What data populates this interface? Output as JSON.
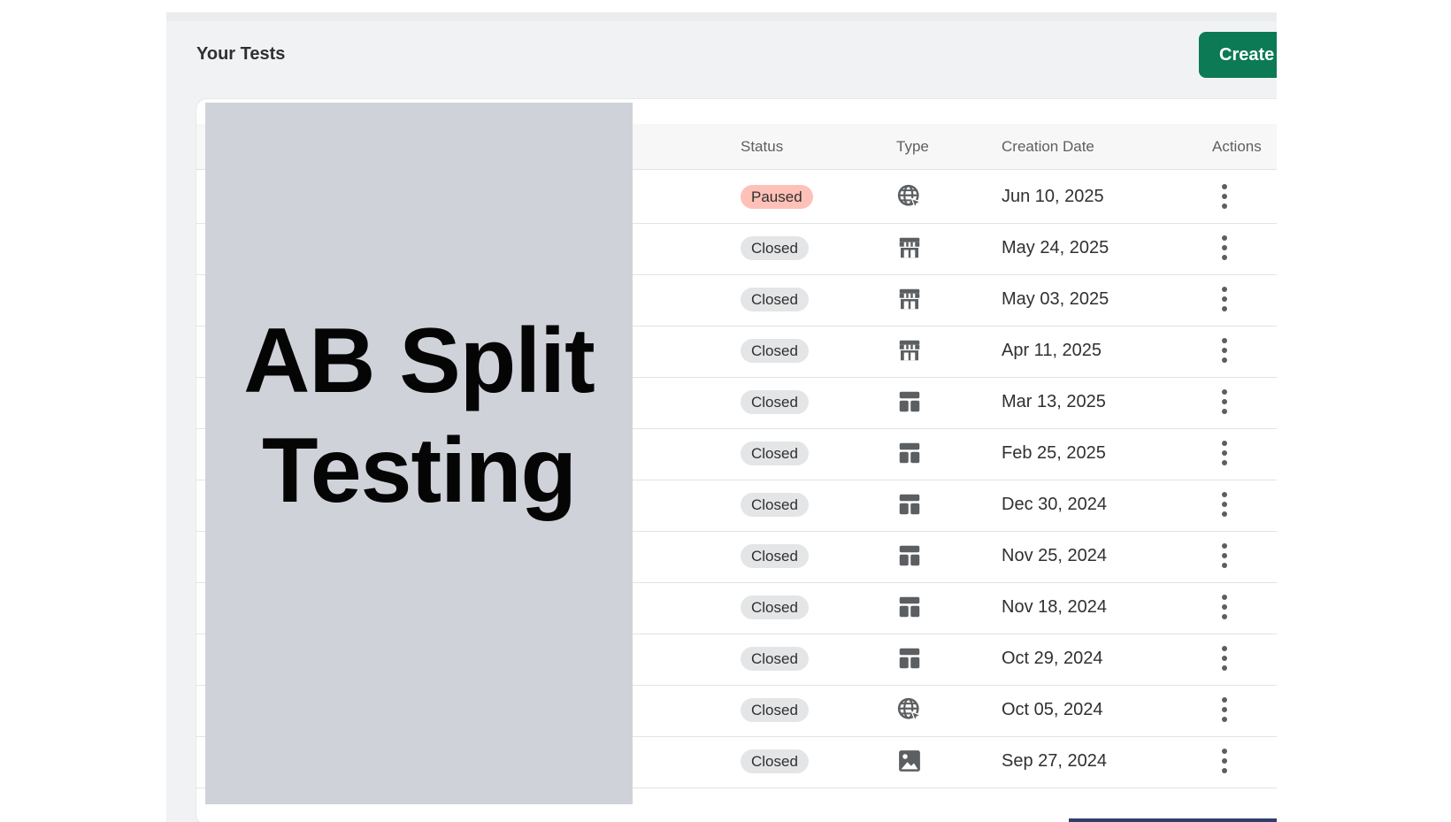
{
  "header": {
    "title": "Your Tests",
    "create_button_label": "Create"
  },
  "table": {
    "columns": {
      "status": "Status",
      "type": "Type",
      "creation_date": "Creation Date",
      "actions": "Actions"
    },
    "rows": [
      {
        "status": "Paused",
        "type_icon": "globe-cursor-icon",
        "date": "Jun 10, 2025"
      },
      {
        "status": "Closed",
        "type_icon": "storefront-icon",
        "date": "May 24, 2025"
      },
      {
        "status": "Closed",
        "type_icon": "storefront-icon",
        "date": "May 03, 2025"
      },
      {
        "status": "Closed",
        "type_icon": "storefront-icon",
        "date": "Apr 11, 2025"
      },
      {
        "status": "Closed",
        "type_icon": "page-layout-icon",
        "date": "Mar 13, 2025"
      },
      {
        "status": "Closed",
        "type_icon": "page-layout-icon",
        "date": "Feb 25, 2025"
      },
      {
        "status": "Closed",
        "type_icon": "page-layout-icon",
        "date": "Dec 30, 2024"
      },
      {
        "status": "Closed",
        "type_icon": "page-layout-icon",
        "date": "Nov 25, 2024"
      },
      {
        "status": "Closed",
        "type_icon": "page-layout-icon",
        "date": "Nov 18, 2024"
      },
      {
        "status": "Closed",
        "type_icon": "page-layout-icon",
        "date": "Oct 29, 2024"
      },
      {
        "status": "Closed",
        "type_icon": "globe-cursor-icon",
        "date": "Oct 05, 2024"
      },
      {
        "status": "Closed",
        "type_icon": "image-icon",
        "date": "Sep 27, 2024"
      }
    ]
  },
  "overlay": {
    "title": "AB Split Testing"
  },
  "colors": {
    "accent": "#0b7a55",
    "paused_badge": "#fec1b8",
    "closed_badge": "#e4e5e7",
    "overlay_bg": "#d0d2da",
    "icon_gray": "#5c5f62"
  }
}
